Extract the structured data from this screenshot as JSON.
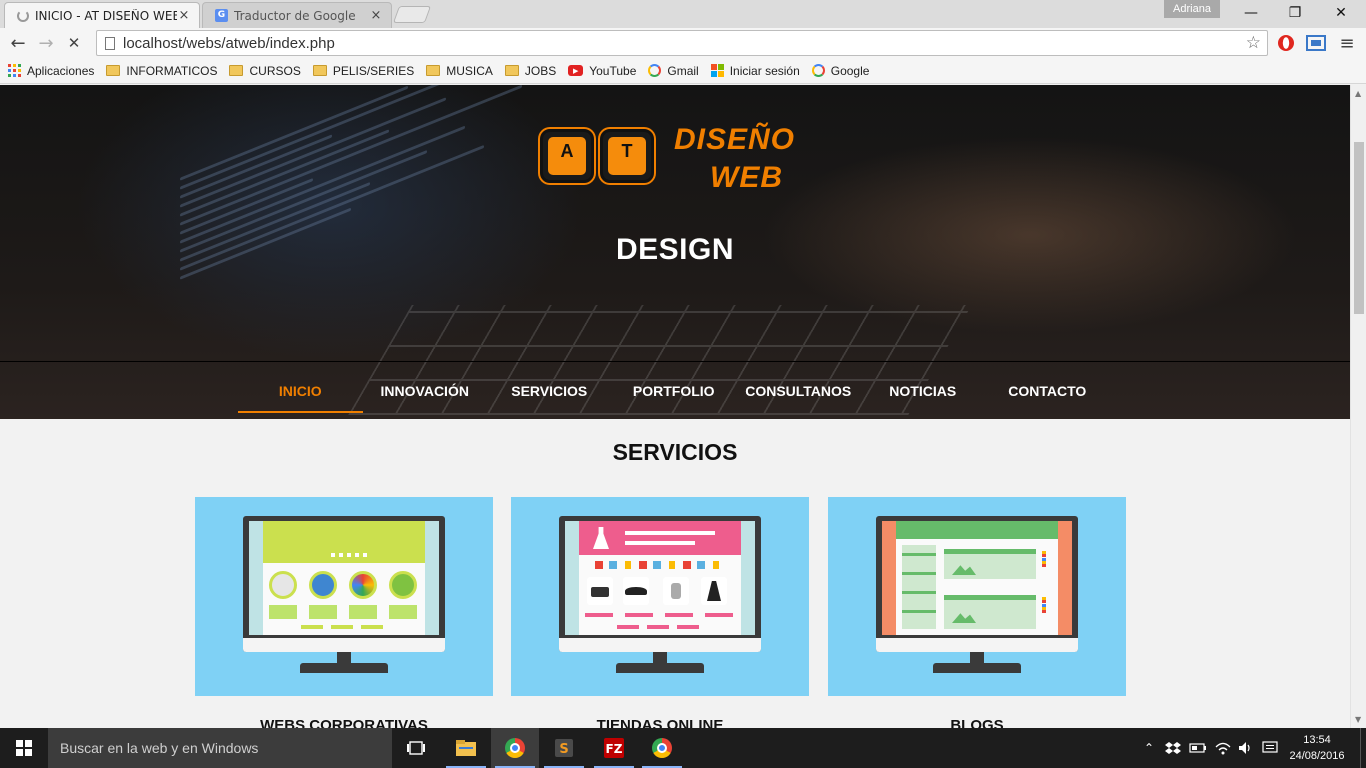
{
  "browser": {
    "tabs": [
      {
        "title": "INICIO - AT DISEÑO WEB",
        "close": "×"
      },
      {
        "title": "Traductor de Google",
        "close": "×"
      }
    ],
    "user": "Adriana",
    "window_controls": {
      "minimize": "—",
      "restore": "❐",
      "close": "✕"
    },
    "nav": {
      "back": "←",
      "forward": "→",
      "stop": "✕"
    },
    "url": "localhost/webs/atweb/index.php",
    "star": "☆",
    "menu": "≡",
    "bookmarks": [
      {
        "label": "Aplicaciones",
        "icon": "apps-grid-icon"
      },
      {
        "label": "INFORMATICOS",
        "icon": "folder-icon"
      },
      {
        "label": "CURSOS",
        "icon": "folder-icon"
      },
      {
        "label": "PELIS/SERIES",
        "icon": "folder-icon"
      },
      {
        "label": "MUSICA",
        "icon": "folder-icon"
      },
      {
        "label": "JOBS",
        "icon": "folder-icon"
      },
      {
        "label": "YouTube",
        "icon": "youtube-icon"
      },
      {
        "label": "Gmail",
        "icon": "google-icon"
      },
      {
        "label": "Iniciar sesión",
        "icon": "microsoft-icon"
      },
      {
        "label": "Google",
        "icon": "google-icon"
      }
    ]
  },
  "site": {
    "logo": {
      "key1": "A",
      "key2": "T",
      "line1": "DISEÑO",
      "line2": "WEB"
    },
    "hero_title": "DESIGN",
    "nav": [
      "INICIO",
      "INNOVACIÓN",
      "SERVICIOS",
      "PORTFOLIO",
      "CONSULTANOS",
      "NOTICIAS",
      "CONTACTO"
    ],
    "active_nav": "INICIO",
    "section_title": "SERVICIOS",
    "services": [
      {
        "label": "WEBS CORPORATIVAS"
      },
      {
        "label": "TIENDAS ONLINE"
      },
      {
        "label": "BLOGS"
      }
    ]
  },
  "taskbar": {
    "search_placeholder": "Buscar en la web y en Windows",
    "clock_time": "13:54",
    "clock_date": "24/08/2016"
  },
  "colors": {
    "accent_orange": "#f07f00",
    "card_blue": "#7fd1f5",
    "taskbar": "#1d1d1d"
  }
}
